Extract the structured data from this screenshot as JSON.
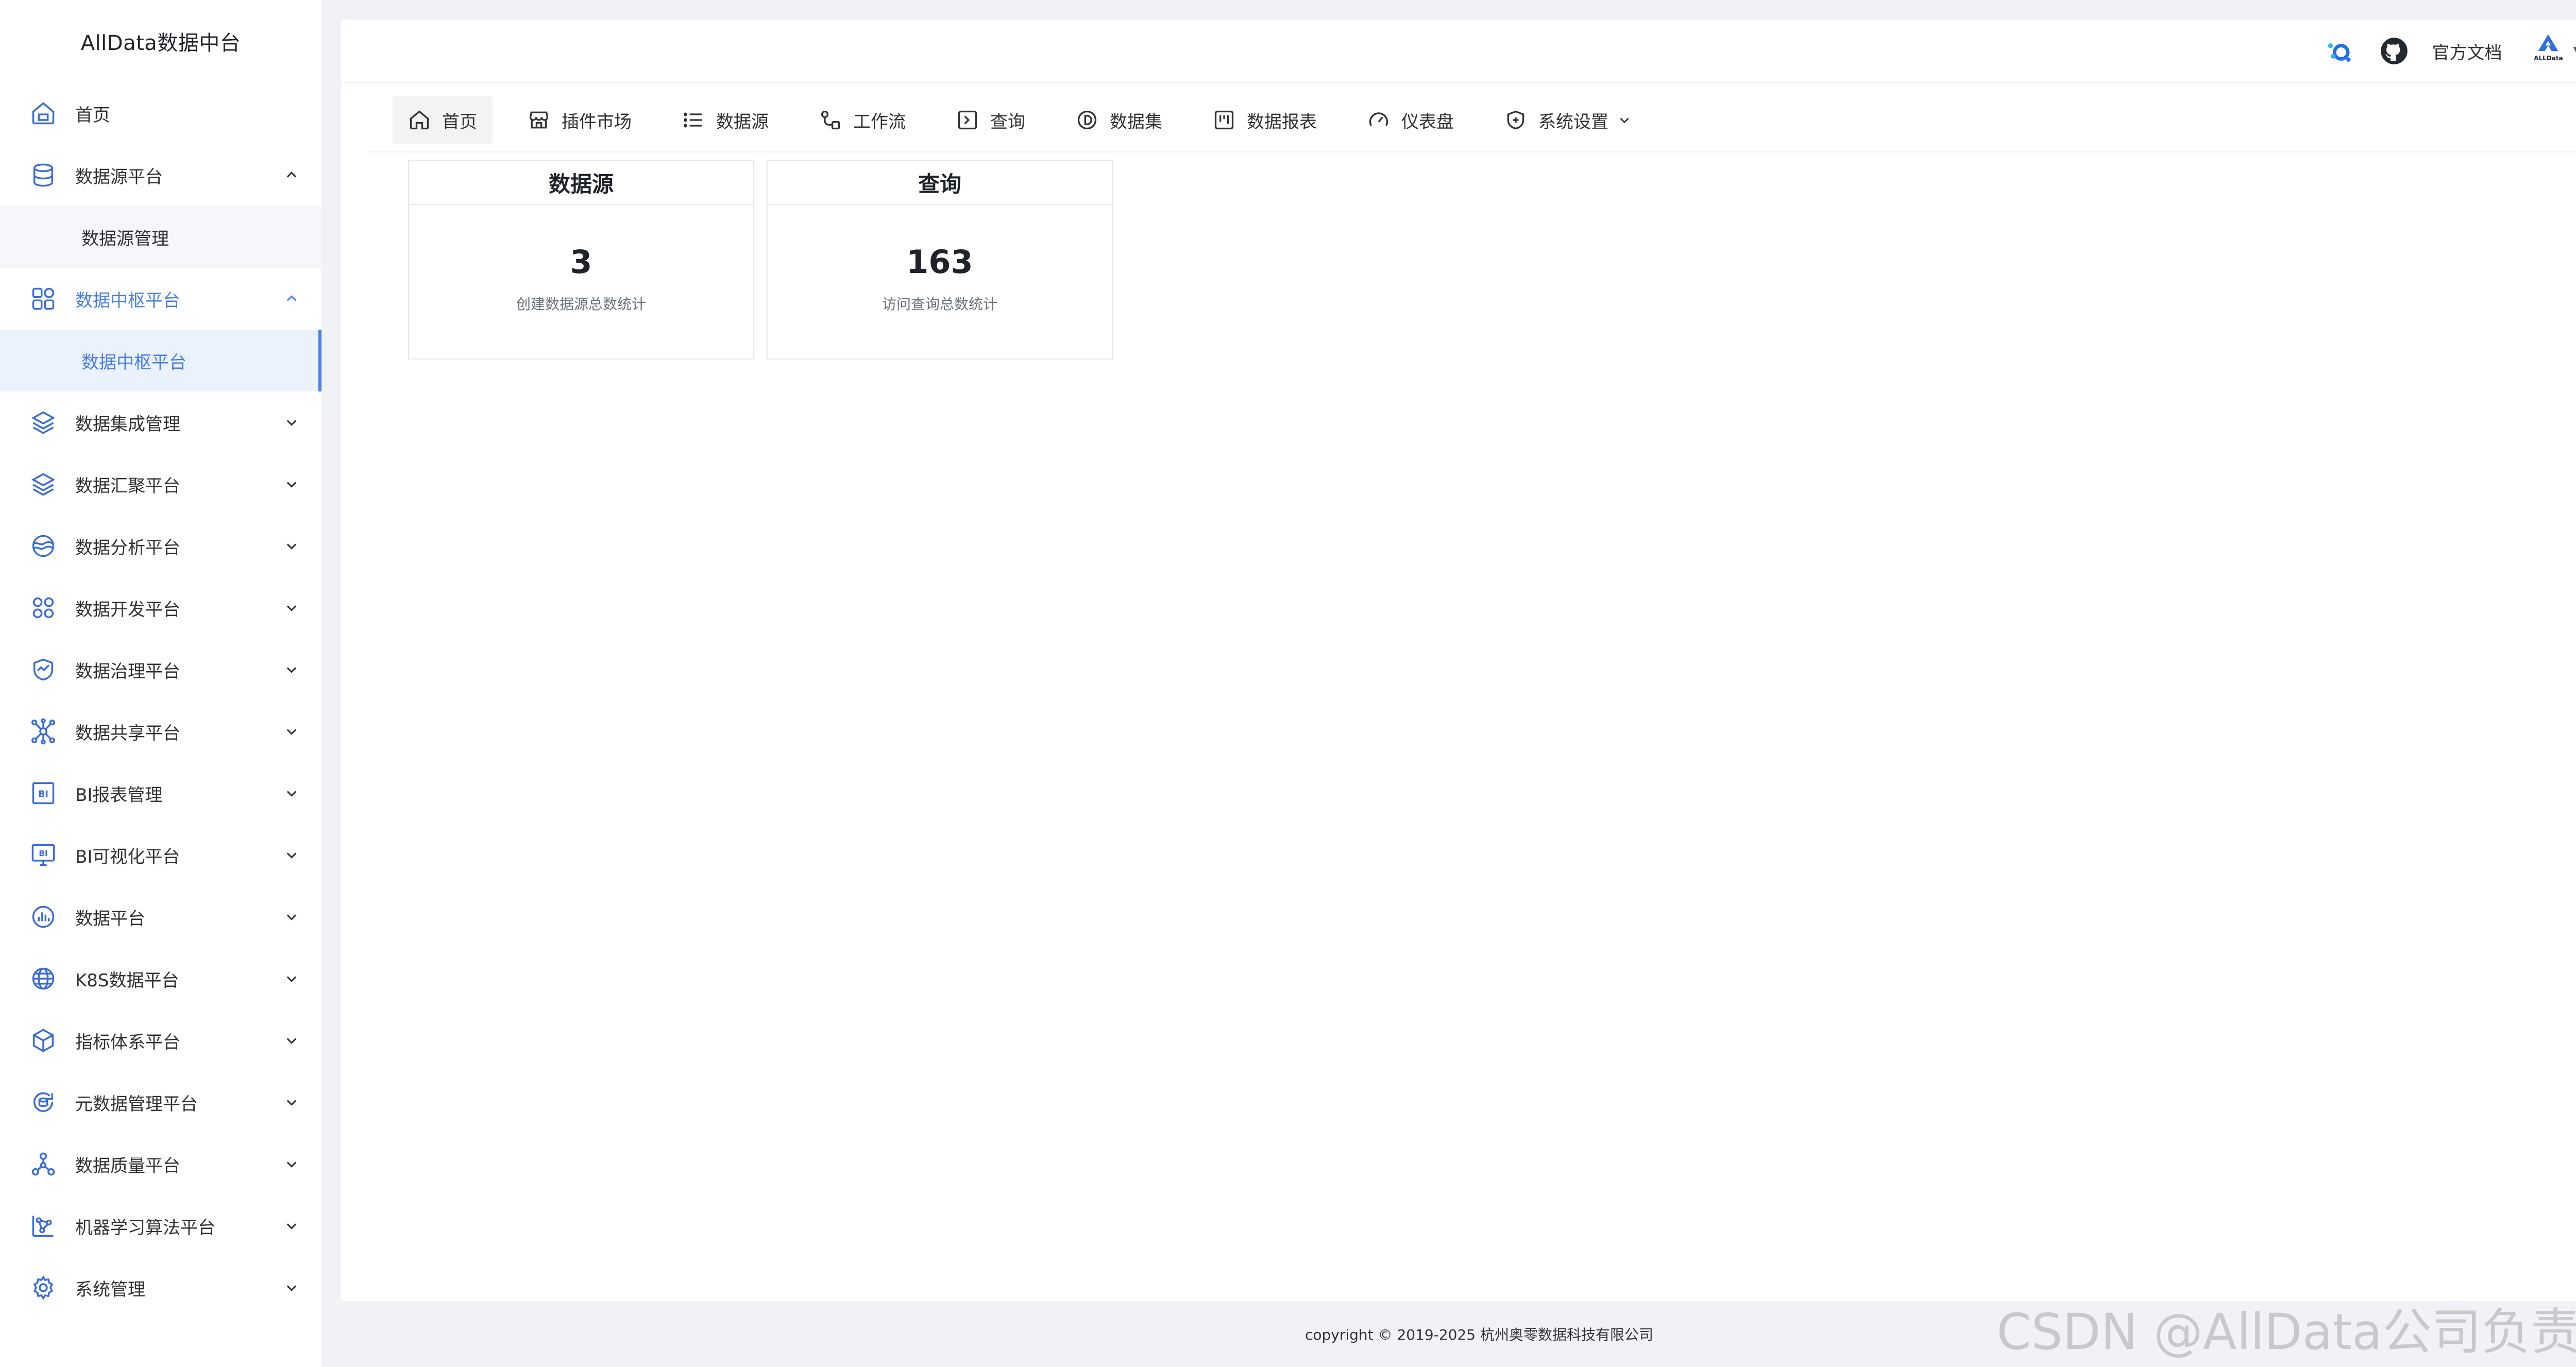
{
  "sidebar": {
    "brand": "AllData数据中台",
    "items": [
      {
        "label": "首页",
        "icon": "home-icon"
      },
      {
        "label": "数据源平台",
        "icon": "database-icon",
        "expanded": true
      },
      {
        "label": "数据源管理",
        "sub": true
      },
      {
        "label": "数据中枢平台",
        "icon": "apps-icon",
        "expanded": true,
        "active": true
      },
      {
        "label": "数据中枢平台",
        "sub": true,
        "selected": true
      },
      {
        "label": "数据集成管理",
        "icon": "layers-icon"
      },
      {
        "label": "数据汇聚平台",
        "icon": "layers-icon"
      },
      {
        "label": "数据分析平台",
        "icon": "analysis-icon"
      },
      {
        "label": "数据开发平台",
        "icon": "dev-grid-icon"
      },
      {
        "label": "数据治理平台",
        "icon": "shield-chart-icon"
      },
      {
        "label": "数据共享平台",
        "icon": "share-network-icon"
      },
      {
        "label": "BI报表管理",
        "icon": "bi-report-icon"
      },
      {
        "label": "BI可视化平台",
        "icon": "bi-screen-icon"
      },
      {
        "label": "数据平台",
        "icon": "bar-circle-icon"
      },
      {
        "label": "K8S数据平台",
        "icon": "globe-icon"
      },
      {
        "label": "指标体系平台",
        "icon": "cube-icon"
      },
      {
        "label": "元数据管理平台",
        "icon": "refresh-data-icon"
      },
      {
        "label": "数据质量平台",
        "icon": "nodes-icon"
      },
      {
        "label": "机器学习算法平台",
        "icon": "ml-icon"
      },
      {
        "label": "系统管理",
        "icon": "gear-icon"
      }
    ]
  },
  "topbar": {
    "docs_label": "官方文档",
    "avatar_logo_text": "ALLData",
    "avatar_caret": "▼"
  },
  "tabs": [
    {
      "label": "首页",
      "icon": "home-icon",
      "active": true
    },
    {
      "label": "插件市场",
      "icon": "store-icon"
    },
    {
      "label": "数据源",
      "icon": "list-icon"
    },
    {
      "label": "工作流",
      "icon": "workflow-icon"
    },
    {
      "label": "查询",
      "icon": "terminal-icon"
    },
    {
      "label": "数据集",
      "icon": "dataset-icon"
    },
    {
      "label": "数据报表",
      "icon": "report-board-icon"
    },
    {
      "label": "仪表盘",
      "icon": "gauge-icon"
    },
    {
      "label": "系统设置",
      "icon": "shield-plus-icon",
      "dropdown": true
    }
  ],
  "cards": [
    {
      "title": "数据源",
      "value": "3",
      "desc": "创建数据源总数统计"
    },
    {
      "title": "查询",
      "value": "163",
      "desc": "访问查询总数统计"
    }
  ],
  "footer": "copyright © 2019-2025 杭州奥零数据科技有限公司",
  "watermark": "CSDN @AllData公司负责人",
  "colors": {
    "accent": "#4a7ee8",
    "icon": "#3a6bd6",
    "background": "#f0f2f5"
  }
}
